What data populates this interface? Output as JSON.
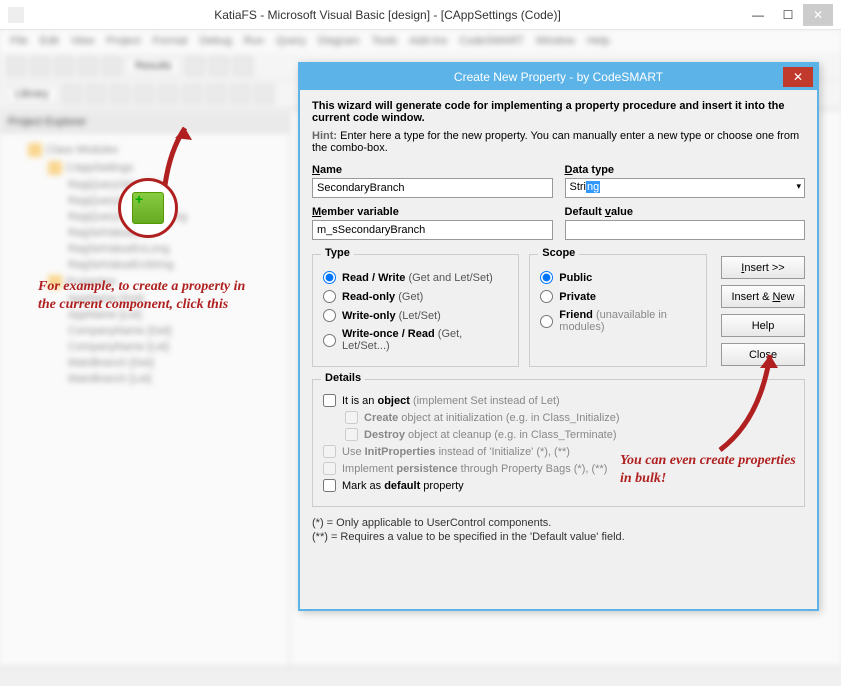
{
  "window": {
    "title": "KatiaFS - Microsoft Visual Basic [design] - [CAppSettings (Code)]"
  },
  "toolbar": {
    "results_label": "Results",
    "library_label": "Library"
  },
  "sidebar": {
    "title": "Project Explorer"
  },
  "annotations": {
    "left": "For example, to create a property in the current component, click this",
    "right": "You can even create properties in bulk!"
  },
  "dialog": {
    "title": "Create New Property - by CodeSMART",
    "intro": "This wizard will generate code for implementing a property procedure and insert it into the current code window.",
    "hint_label": "Hint:",
    "hint_text": "Enter here a type for the new property. You can manually enter a new type or choose one from the combo-box.",
    "fields": {
      "name_label": "Name",
      "name_value": "SecondaryBranch",
      "datatype_label": "Data type",
      "datatype_prefix": "Stri",
      "datatype_selected": "ng",
      "member_label": "Member variable",
      "member_value": "m_sSecondaryBranch",
      "default_label": "Default value",
      "default_value": ""
    },
    "type_group": {
      "title": "Type",
      "options": [
        {
          "label": "Read / Write",
          "paren": "(Get and Let/Set)",
          "checked": true
        },
        {
          "label": "Read-only",
          "paren": "(Get)",
          "checked": false
        },
        {
          "label": "Write-only",
          "paren": "(Let/Set)",
          "checked": false
        },
        {
          "label": "Write-once / Read",
          "paren": "(Get, Let/Set...)",
          "checked": false
        }
      ]
    },
    "scope_group": {
      "title": "Scope",
      "options": [
        {
          "label": "Public",
          "checked": true,
          "note": ""
        },
        {
          "label": "Private",
          "checked": false,
          "note": ""
        },
        {
          "label": "Friend",
          "checked": false,
          "note": "(unavailable in modules)"
        }
      ]
    },
    "buttons": {
      "insert": "Insert >>",
      "insert_new": "Insert & New",
      "help": "Help",
      "close": "Close"
    },
    "details": {
      "title": "Details",
      "is_object": "It is an object (implement Set instead of Let)",
      "create_obj": "Create object at initialization (e.g. in Class_Initialize)",
      "destroy_obj": "Destroy object at cleanup (e.g. in Class_Terminate)",
      "init_props": "Use InitProperties instead of 'Initialize' (*), (**)",
      "persistence": "Implement persistence through Property Bags (*), (**)",
      "default_prop": "Mark as default property"
    },
    "footnotes": {
      "f1": "(*) = Only applicable to UserControl components.",
      "f2": "(**) = Requires a value to be specified in the 'Default value' field."
    }
  }
}
